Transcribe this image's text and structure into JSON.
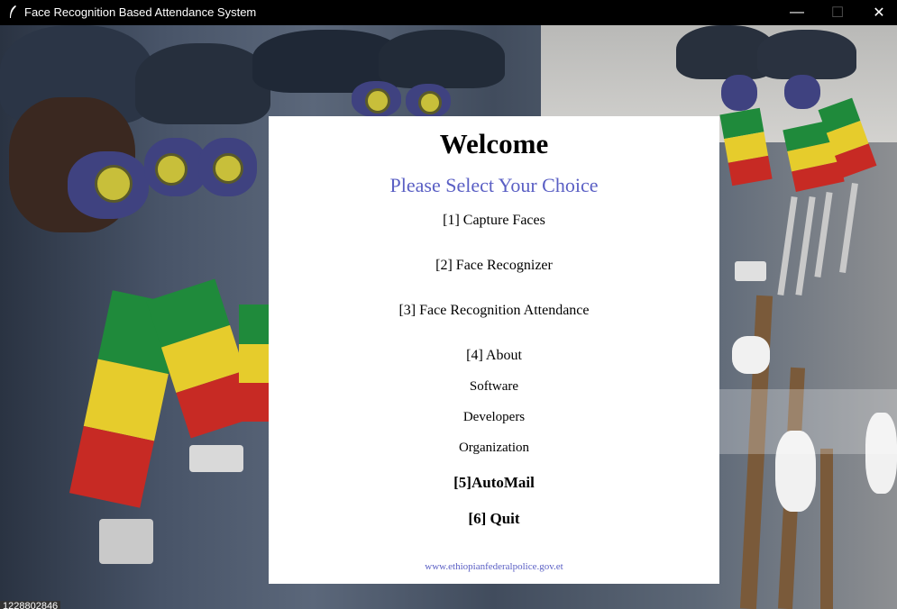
{
  "window": {
    "title": "Face Recognition Based Attendance System",
    "minimize_symbol": "—",
    "maximize_symbol": "☐",
    "close_symbol": "✕"
  },
  "panel": {
    "welcome": "Welcome",
    "subtitle": "Please Select Your Choice",
    "options": {
      "capture": "[1] Capture Faces",
      "recognizer": "[2] Face Recognizer",
      "attendance": "[3] Face Recognition Attendance",
      "about": "[4] About",
      "software": "Software",
      "developers": "Developers",
      "organization": "Organization",
      "automail": "[5]AutoMail",
      "quit": "[6] Quit"
    },
    "website": "www.ethiopianfederalpolice.gov.et"
  },
  "footer": {
    "counter": "1228802846"
  },
  "colors": {
    "accent": "#5a5fc4",
    "titlebar": "#000000",
    "panel": "#ffffff"
  }
}
